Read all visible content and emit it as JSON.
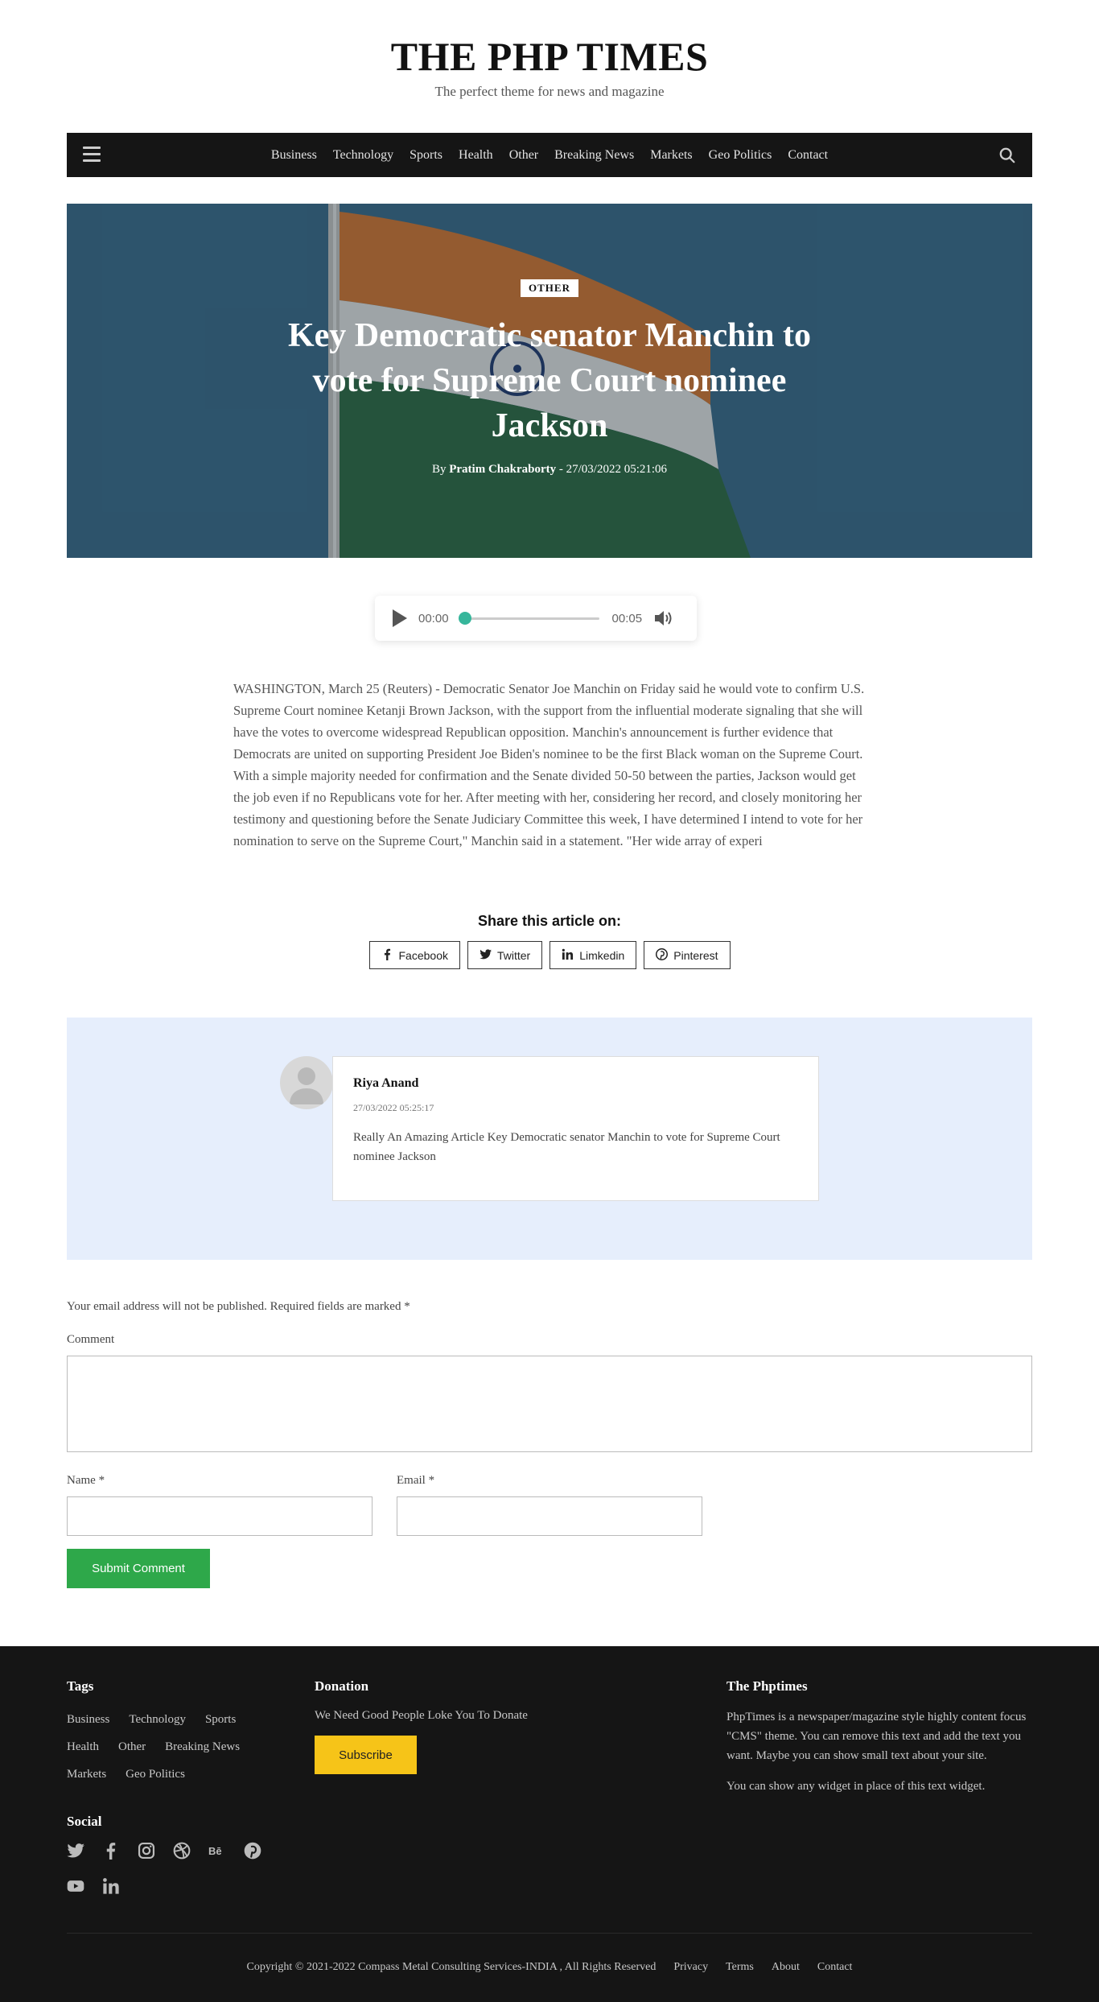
{
  "site": {
    "title": "THE PHP TIMES",
    "tagline": "The perfect theme for news and magazine"
  },
  "nav": {
    "items": [
      "Business",
      "Technology",
      "Sports",
      "Health",
      "Other",
      "Breaking News",
      "Markets",
      "Geo Politics",
      "Contact"
    ],
    "menu_icon": "hamburger-icon",
    "search_icon": "search-icon"
  },
  "article": {
    "category": "OTHER",
    "title": "Key Democratic senator Manchin to vote for Supreme Court nominee Jackson",
    "by_label": "By",
    "author": "Pratim Chakraborty",
    "datetime": "- 27/03/2022 05:21:06",
    "body": "WASHINGTON, March 25 (Reuters) - Democratic Senator Joe Manchin on Friday said he would vote to confirm U.S. Supreme Court nominee Ketanji Brown Jackson, with the support from the influential moderate signaling that she will have the votes to overcome widespread Republican opposition. Manchin's announcement is further evidence that Democrats are united on supporting President Joe Biden's nominee to be the first Black woman on the Supreme Court. With a simple majority needed for confirmation and the Senate divided 50-50 between the parties, Jackson would get the job even if no Republicans vote for her. After meeting with her, considering her record, and closely monitoring her testimony and questioning before the Senate Judiciary Committee this week, I have determined I intend to vote for her nomination to serve on the Supreme Court,\" Manchin said in a statement. \"Her wide array of experi"
  },
  "audio": {
    "current_time": "00:00",
    "duration": "00:05",
    "progress_fraction": 0.0
  },
  "share": {
    "title": "Share this article on:",
    "buttons": [
      {
        "label": "Facebook",
        "icon": "facebook-icon"
      },
      {
        "label": "Twitter",
        "icon": "twitter-icon"
      },
      {
        "label": "Limkedin",
        "icon": "linkedin-icon"
      },
      {
        "label": "Pinterest",
        "icon": "pinterest-icon"
      }
    ]
  },
  "comments": [
    {
      "author": "Riya Anand",
      "date": "27/03/2022 05:25:17",
      "text": "Really An Amazing Article Key Democratic senator Manchin to vote for Supreme Court nominee Jackson"
    }
  ],
  "form": {
    "note": "Your email address will not be published. Required fields are marked *",
    "comment_label": "Comment",
    "name_label": "Name *",
    "email_label": "Email *",
    "submit_label": "Submit Comment"
  },
  "footer": {
    "tags_title": "Tags",
    "tags": [
      "Business",
      "Technology",
      "Sports",
      "Health",
      "Other",
      "Breaking News",
      "Markets",
      "Geo Politics"
    ],
    "social_title": "Social",
    "social_icons": [
      "twitter-icon",
      "facebook-icon",
      "instagram-icon",
      "dribbble-icon",
      "behance-icon",
      "pinterest-icon",
      "youtube-icon",
      "linkedin-icon"
    ],
    "donation_title": "Donation",
    "donation_text": "We Need Good People Loke You To Donate",
    "subscribe_label": "Subscribe",
    "about_title": "The Phptimes",
    "about_text": "PhpTimes is a newspaper/magazine style highly content focus \"CMS\" theme. You can remove this text and add the text you want. Maybe you can show small text about your site.",
    "about_text2": "You can show any widget in place of this text widget.",
    "copyright": "Copyright © 2021-2022 Compass Metal Consulting Services-INDIA , All Rights Reserved",
    "bottom_links": [
      "Privacy",
      "Terms",
      "About",
      "Contact"
    ]
  },
  "colors": {
    "nav_bg": "#151515",
    "accent_green": "#2ea84a",
    "audio_accent": "#36b69b",
    "subscribe_yellow": "#f6c418",
    "comments_bg": "#e6eefc"
  }
}
